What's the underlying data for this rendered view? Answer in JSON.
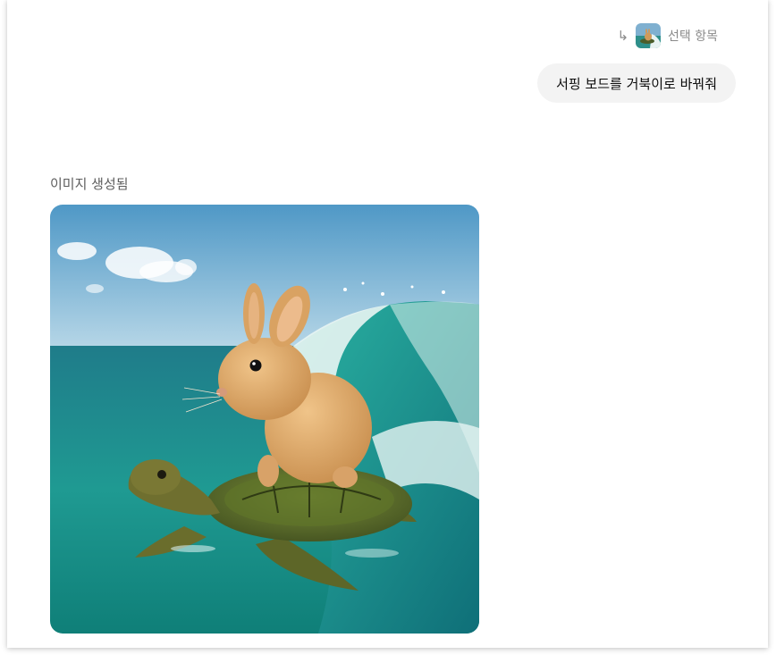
{
  "reply_reference": {
    "arrow_icon": "reply-arrow-icon",
    "label": "선택 항목"
  },
  "user_message": {
    "text": "서핑 보드를 거북이로 바꿔줘"
  },
  "assistant_message": {
    "status_label": "이미지 생성됨"
  }
}
